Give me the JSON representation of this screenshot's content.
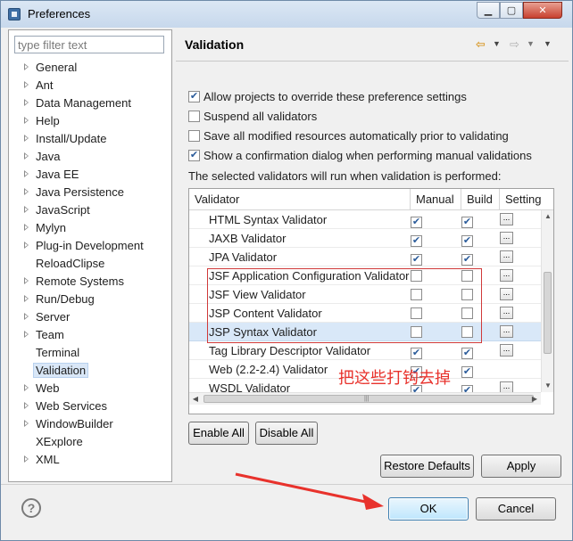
{
  "window": {
    "title": "Preferences",
    "min_label": "▁",
    "max_label": "▢",
    "close_label": "✕"
  },
  "filter": {
    "placeholder": "type filter text",
    "value": ""
  },
  "tree": {
    "items": [
      {
        "label": "General",
        "expandable": true
      },
      {
        "label": "Ant",
        "expandable": true
      },
      {
        "label": "Data Management",
        "expandable": true
      },
      {
        "label": "Help",
        "expandable": true
      },
      {
        "label": "Install/Update",
        "expandable": true
      },
      {
        "label": "Java",
        "expandable": true
      },
      {
        "label": "Java EE",
        "expandable": true
      },
      {
        "label": "Java Persistence",
        "expandable": true
      },
      {
        "label": "JavaScript",
        "expandable": true
      },
      {
        "label": "Mylyn",
        "expandable": true
      },
      {
        "label": "Plug-in Development",
        "expandable": true
      },
      {
        "label": "ReloadClipse",
        "expandable": false
      },
      {
        "label": "Remote Systems",
        "expandable": true
      },
      {
        "label": "Run/Debug",
        "expandable": true
      },
      {
        "label": "Server",
        "expandable": true
      },
      {
        "label": "Team",
        "expandable": true
      },
      {
        "label": "Terminal",
        "expandable": false
      },
      {
        "label": "Validation",
        "expandable": false,
        "selected": true
      },
      {
        "label": "Web",
        "expandable": true
      },
      {
        "label": "Web Services",
        "expandable": true
      },
      {
        "label": "WindowBuilder",
        "expandable": true
      },
      {
        "label": "XExplore",
        "expandable": false
      },
      {
        "label": "XML",
        "expandable": true
      }
    ]
  },
  "page": {
    "title": "Validation",
    "nav_back": "⇦",
    "nav_dropdown": "▼",
    "nav_forward": "⇨",
    "nav_menu": "▼"
  },
  "options": [
    {
      "label": "Allow projects to override these preference settings",
      "checked": true
    },
    {
      "label": "Suspend all validators",
      "checked": false
    },
    {
      "label": "Save all modified resources automatically prior to validating",
      "checked": false
    },
    {
      "label": "Show a confirmation dialog when performing manual validations",
      "checked": true
    }
  ],
  "info_text": "The selected validators will run when validation is performed:",
  "table": {
    "headers": {
      "validator": "Validator",
      "manual": "Manual",
      "build": "Build",
      "settings": "Settings"
    },
    "rows": [
      {
        "name": "HTML Syntax Validator",
        "manual": true,
        "build": true,
        "settings": true
      },
      {
        "name": "JAXB Validator",
        "manual": true,
        "build": true,
        "settings": true
      },
      {
        "name": "JPA Validator",
        "manual": true,
        "build": true,
        "settings": true
      },
      {
        "name": "JSF Application Configuration Validator",
        "manual": false,
        "build": false,
        "settings": true
      },
      {
        "name": "JSF View Validator",
        "manual": false,
        "build": false,
        "settings": true
      },
      {
        "name": "JSP Content Validator",
        "manual": false,
        "build": false,
        "settings": true
      },
      {
        "name": "JSP Syntax Validator",
        "manual": false,
        "build": false,
        "settings": true,
        "highlight": true
      },
      {
        "name": "Tag Library Descriptor Validator",
        "manual": true,
        "build": true,
        "settings": true
      },
      {
        "name": "Web (2.2-2.4) Validator",
        "manual": true,
        "build": true,
        "settings": false
      },
      {
        "name": "WSDL Validator",
        "manual": true,
        "build": true,
        "settings": true
      }
    ],
    "settings_glyph": "...",
    "scroll_up": "▲",
    "scroll_down": "▼",
    "scroll_left": "◀",
    "scroll_right": "▶",
    "scroll_grip": "|||"
  },
  "buttons": {
    "enable_all": "Enable All",
    "disable_all": "Disable All",
    "restore_defaults": "Restore Defaults",
    "apply": "Apply",
    "ok": "OK",
    "cancel": "Cancel",
    "help": "?"
  },
  "annotation": {
    "text": "把这些打钩去掉",
    "color": "#e8322c"
  }
}
